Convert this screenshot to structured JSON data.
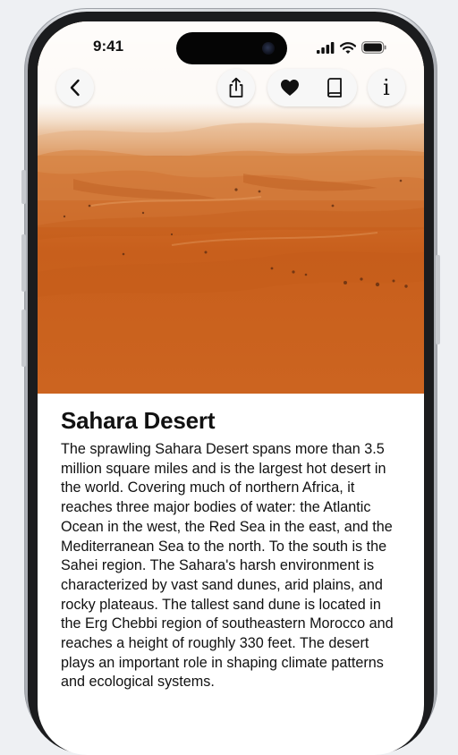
{
  "status_bar": {
    "time": "9:41"
  },
  "nav": {
    "back_icon": "chevron-left-icon",
    "share_icon": "share-icon",
    "favorite_icon": "heart-icon",
    "book_icon": "book-icon",
    "info_icon": "info-icon",
    "info_glyph": "i"
  },
  "hero_image": {
    "subject": "desert-dunes"
  },
  "article": {
    "title": "Sahara Desert",
    "body": "The sprawling Sahara Desert spans more than 3.5 million square miles and is the largest hot desert in the world. Covering much of northern Africa, it reaches three major bodies of water: the Atlantic Ocean in the west, the Red Sea in the east, and the Mediterranean Sea to the north. To the south is the Sahei region. The Sahara's harsh environment is characterized by vast sand dunes, arid plains, and rocky plateaus. The tallest sand dune is located in the Erg Chebbi region of southeastern Morocco and reaches a height of roughly 330 feet. The desert plays an important role in shaping climate patterns and ecological systems."
  },
  "colors": {
    "sand": "#cc6420",
    "background": "#eef0f3",
    "frame": "#1b1c1e",
    "text": "#111111"
  }
}
